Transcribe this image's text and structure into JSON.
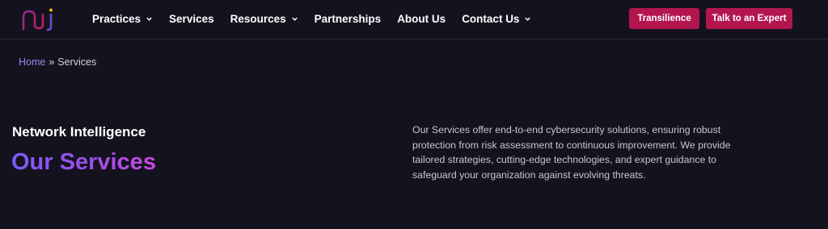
{
  "header": {
    "logo_icon": "nj-logo-icon",
    "nav": [
      {
        "label": "Practices",
        "has_dropdown": true
      },
      {
        "label": "Services",
        "has_dropdown": false
      },
      {
        "label": "Resources",
        "has_dropdown": true
      },
      {
        "label": "Partnerships",
        "has_dropdown": false
      },
      {
        "label": "About Us",
        "has_dropdown": false
      },
      {
        "label": "Contact Us",
        "has_dropdown": true
      }
    ],
    "buttons": {
      "transilience": "Transilience",
      "talk_to_expert": "Talk to an Expert"
    }
  },
  "breadcrumb": {
    "home": "Home",
    "separator": "»",
    "current": "Services"
  },
  "hero": {
    "eyebrow": "Network Intelligence",
    "title": "Our Services",
    "description": "Our Services offer end-to-end cybersecurity solutions, ensuring robust protection from risk assessment to continuous improvement. We provide tailored strategies, cutting-edge technologies, and expert guidance to safeguard your organization against evolving threats."
  },
  "colors": {
    "background": "#15121f",
    "button": "#b3164f",
    "breadcrumb_link": "#8c8cf2",
    "title_gradient_start": "#7a5cf7",
    "title_gradient_end": "#c64be0"
  }
}
